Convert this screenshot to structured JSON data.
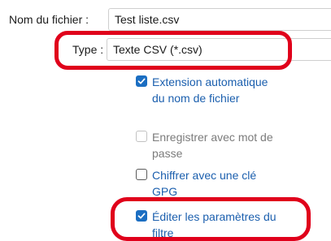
{
  "form": {
    "filename_label": "Nom du fichier :",
    "filename_value": "Test liste.csv",
    "type_label": "Type :",
    "type_value": "Texte CSV (*.csv)"
  },
  "options": [
    {
      "label": "Extension automatique du nom de fichier",
      "checked": true,
      "enabled": true
    },
    {
      "label": "Enregistrer avec mot de passe",
      "checked": false,
      "enabled": false
    },
    {
      "label": "Chiffrer avec une clé GPG",
      "checked": false,
      "enabled": true
    },
    {
      "label": "Éditer les paramètres du filtre",
      "checked": true,
      "enabled": true
    }
  ],
  "colors": {
    "accent": "#1b6ec2",
    "link_text": "#1b5fae",
    "annotation": "#e0001b"
  }
}
